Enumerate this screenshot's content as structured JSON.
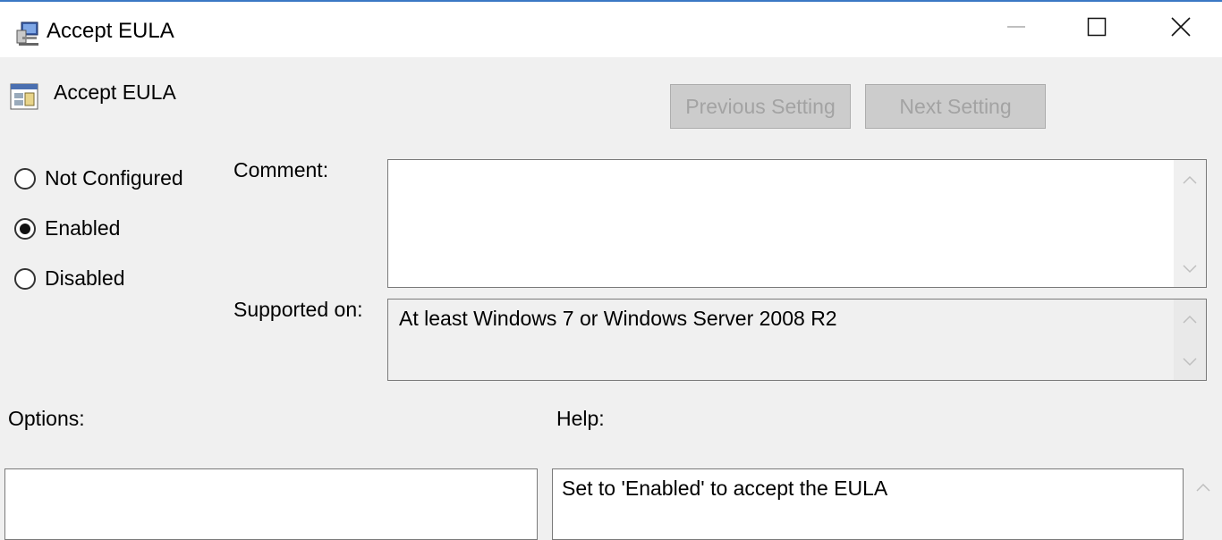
{
  "window": {
    "title": "Accept EULA"
  },
  "header": {
    "setting_name": "Accept EULA"
  },
  "nav": {
    "previous_label": "Previous Setting",
    "next_label": "Next Setting"
  },
  "state": {
    "options": [
      {
        "label": "Not Configured",
        "selected": false
      },
      {
        "label": "Enabled",
        "selected": true
      },
      {
        "label": "Disabled",
        "selected": false
      }
    ]
  },
  "comment": {
    "label": "Comment:",
    "value": ""
  },
  "supported": {
    "label": "Supported on:",
    "value": "At least Windows 7 or Windows Server 2008 R2"
  },
  "sections": {
    "options_label": "Options:",
    "help_label": "Help:"
  },
  "help": {
    "text": "Set to 'Enabled' to accept the EULA"
  },
  "colors": {
    "accent_line": "#3a78c4",
    "background": "#f0f0f0",
    "disabled_text": "#a3a3a3"
  }
}
